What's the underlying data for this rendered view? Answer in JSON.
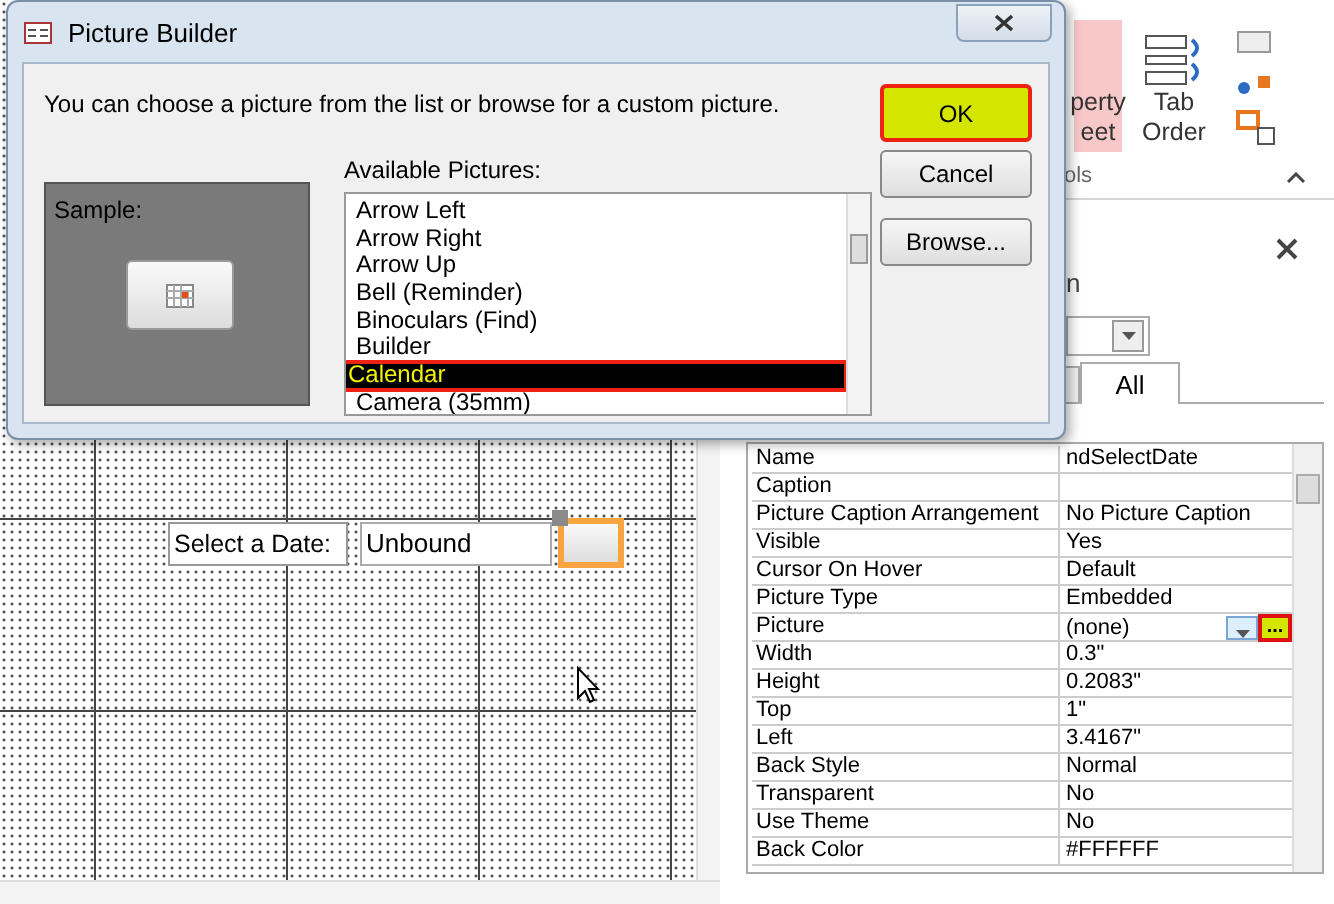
{
  "ribbon": {
    "buttons": [
      {
        "lines": [
          "perty",
          "eet"
        ],
        "selected": true
      },
      {
        "lines": [
          "Tab",
          "Order"
        ],
        "selected": false
      }
    ],
    "group_label": "ols"
  },
  "property_sheet": {
    "heading": "n",
    "tabs": [
      {
        "label": "All",
        "selected": true
      }
    ],
    "rows": [
      {
        "name": "Name",
        "value": "ndSelectDate",
        "kind": "text"
      },
      {
        "name": "Caption",
        "value": "",
        "kind": "text"
      },
      {
        "name": "Picture Caption Arrangement",
        "value": "No Picture Caption",
        "kind": "text"
      },
      {
        "name": "Visible",
        "value": "Yes",
        "kind": "text"
      },
      {
        "name": "Cursor On Hover",
        "value": "Default",
        "kind": "text"
      },
      {
        "name": "Picture Type",
        "value": "Embedded",
        "kind": "text"
      },
      {
        "name": "Picture",
        "value": "(none)",
        "kind": "builder",
        "builder_label": "...",
        "highlighted": true
      },
      {
        "name": "Width",
        "value": "0.3\"",
        "kind": "text"
      },
      {
        "name": "Height",
        "value": "0.2083\"",
        "kind": "text"
      },
      {
        "name": "Top",
        "value": "1\"",
        "kind": "text"
      },
      {
        "name": "Left",
        "value": "3.4167\"",
        "kind": "text"
      },
      {
        "name": "Back Style",
        "value": "Normal",
        "kind": "text"
      },
      {
        "name": "Transparent",
        "value": "No",
        "kind": "text"
      },
      {
        "name": "Use Theme",
        "value": "No",
        "kind": "text"
      },
      {
        "name": "Back Color",
        "value": "#FFFFFF",
        "kind": "text"
      }
    ]
  },
  "design": {
    "label": "Select a Date:",
    "textbox": "Unbound",
    "button_selected": true
  },
  "dialog": {
    "title": "Picture Builder",
    "instruction": "You can choose a picture from the list or browse for a custom picture.",
    "sample_label": "Sample:",
    "list_label": "Available Pictures:",
    "items": [
      {
        "label": "Arrow Left",
        "selected": false,
        "highlighted": false
      },
      {
        "label": "Arrow Right",
        "selected": false,
        "highlighted": false
      },
      {
        "label": "Arrow Up",
        "selected": false,
        "highlighted": false
      },
      {
        "label": "Bell (Reminder)",
        "selected": false,
        "highlighted": false
      },
      {
        "label": "Binoculars (Find)",
        "selected": false,
        "highlighted": false
      },
      {
        "label": "Builder",
        "selected": false,
        "highlighted": false
      },
      {
        "label": "Calendar",
        "selected": true,
        "highlighted": true
      },
      {
        "label": "Camera (35mm)",
        "selected": false,
        "highlighted": false
      }
    ],
    "buttons": [
      {
        "label": "OK",
        "highlighted": true
      },
      {
        "label": "Cancel",
        "highlighted": false
      },
      {
        "label": "Browse...",
        "highlighted": false
      }
    ]
  }
}
